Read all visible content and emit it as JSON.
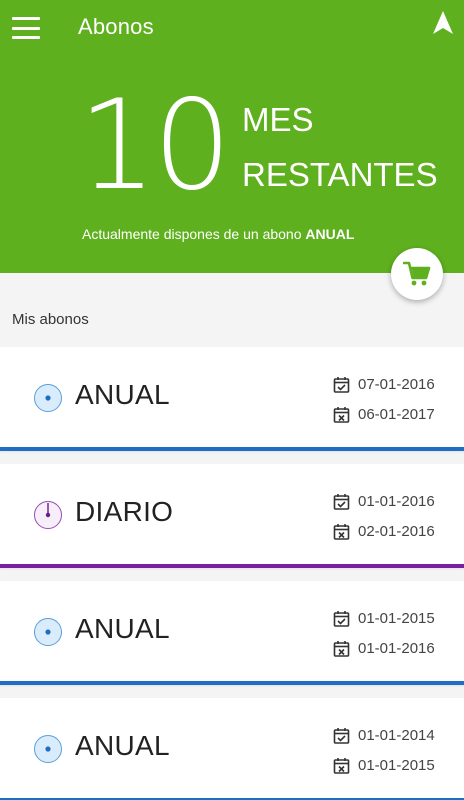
{
  "header": {
    "title": "Abonos",
    "remaining_value": "10",
    "remaining_unit_top": "MES",
    "remaining_unit_bottom": "RESTANTES",
    "status_prefix": "Actualmente dispones de un abono",
    "status_type": "ANUAL",
    "background_color": "#5fb01f"
  },
  "section": {
    "label": "Mis abonos"
  },
  "icons": {
    "menu": "hamburger-menu-icon",
    "navigation": "navigation-arrow-icon",
    "cart": "shopping-cart-icon",
    "start_date": "calendar-check-icon",
    "end_date": "calendar-x-icon"
  },
  "subscriptions": [
    {
      "type": "ANUAL",
      "start": "07-01-2016",
      "end": "06-01-2017",
      "color": "#1f6ec4",
      "icon": "annual-dot-icon"
    },
    {
      "type": "DIARIO",
      "start": "01-01-2016",
      "end": "02-01-2016",
      "color": "#7b1fa2",
      "icon": "daily-clock-icon"
    },
    {
      "type": "ANUAL",
      "start": "01-01-2015",
      "end": "01-01-2016",
      "color": "#1f6ec4",
      "icon": "annual-dot-icon"
    },
    {
      "type": "ANUAL",
      "start": "01-01-2014",
      "end": "01-01-2015",
      "color": "#1f6ec4",
      "icon": "annual-dot-icon"
    }
  ]
}
